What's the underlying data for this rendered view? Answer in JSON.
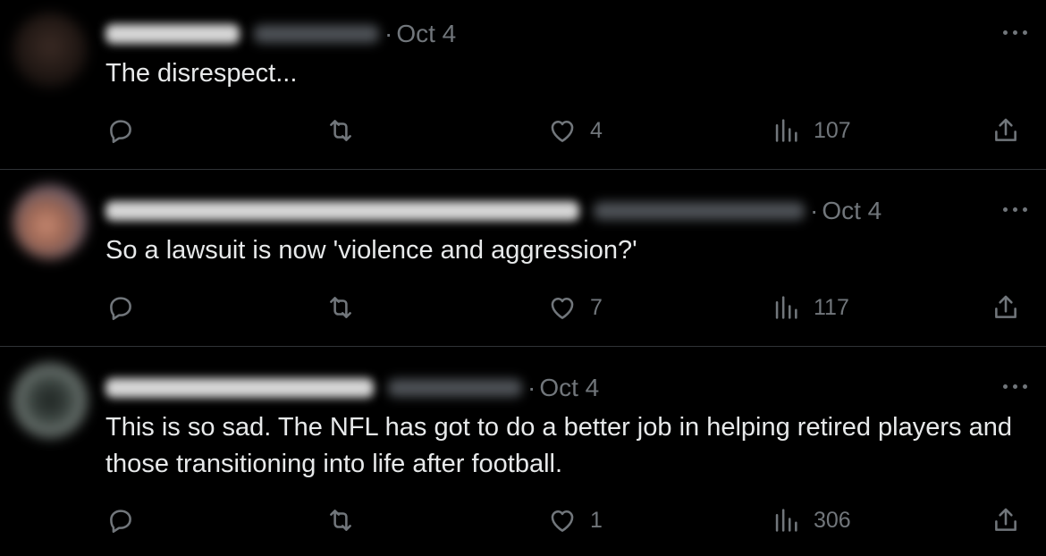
{
  "tweets": [
    {
      "date_sep": "·",
      "date": "Oct 4",
      "text": "The disrespect...",
      "actions": {
        "replies": "",
        "retweets": "",
        "likes": "4",
        "views": "107"
      }
    },
    {
      "date_sep": "·",
      "date": "Oct 4",
      "text": "So a lawsuit is now 'violence and aggression?'",
      "actions": {
        "replies": "",
        "retweets": "",
        "likes": "7",
        "views": "117"
      }
    },
    {
      "date_sep": "·",
      "date": "Oct 4",
      "text": "This is so sad. The NFL has got to do a better job in helping retired players and those transitioning into life after football.",
      "actions": {
        "replies": "",
        "retweets": "",
        "likes": "1",
        "views": "306"
      }
    }
  ],
  "icons": {
    "reply": "reply-icon",
    "retweet": "retweet-icon",
    "like": "heart-icon",
    "views": "views-icon",
    "share": "share-icon",
    "more": "more-icon"
  },
  "colors": {
    "background": "#000000",
    "text": "#e7e9ea",
    "muted": "#71767b",
    "divider": "#2f3336"
  }
}
